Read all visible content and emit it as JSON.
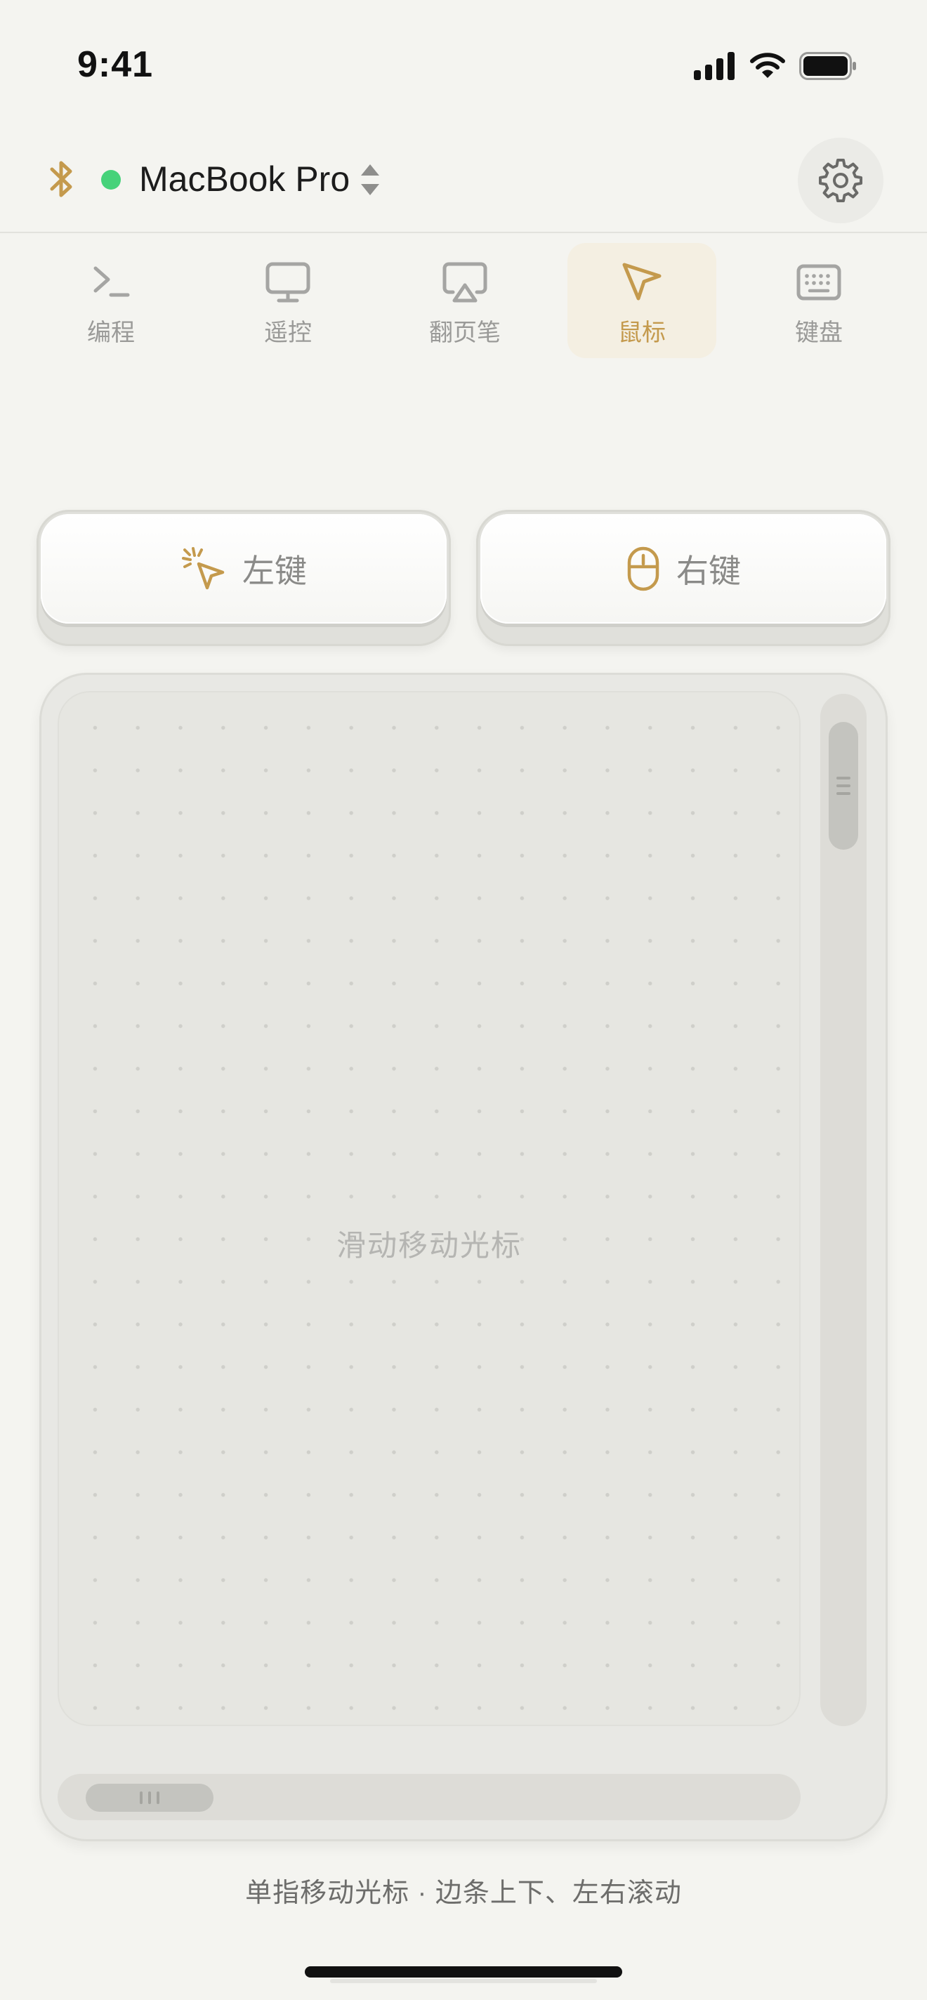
{
  "status_bar": {
    "time": "9:41",
    "icons": [
      "signal-icon",
      "wifi-icon",
      "battery-icon"
    ]
  },
  "header": {
    "connection_icon": "bluetooth-icon",
    "connection_status": "connected",
    "status_color": "#46d27a",
    "device_name": "MacBook Pro",
    "device_switch_icon": "chevron-up-down-icon",
    "settings_icon": "gear-icon"
  },
  "tabs": [
    {
      "label": "编程",
      "icon": "terminal-icon",
      "active": false
    },
    {
      "label": "遥控",
      "icon": "monitor-icon",
      "active": false
    },
    {
      "label": "翻页笔",
      "icon": "airplay-icon",
      "active": false
    },
    {
      "label": "鼠标",
      "icon": "cursor-icon",
      "active": true
    },
    {
      "label": "键盘",
      "icon": "keyboard-icon",
      "active": false
    }
  ],
  "mouse_buttons": {
    "left": {
      "label": "左键",
      "icon": "cursor-click-icon"
    },
    "right": {
      "label": "右键",
      "icon": "mouse-icon"
    }
  },
  "trackpad": {
    "hint": "滑动移动光标"
  },
  "footer": {
    "hint": "单指移动光标 · 边条上下、左右滚动"
  },
  "colors": {
    "accent": "#c49a4d",
    "background": "#f4f4f0",
    "active_tab_bg": "#f4efe2"
  }
}
